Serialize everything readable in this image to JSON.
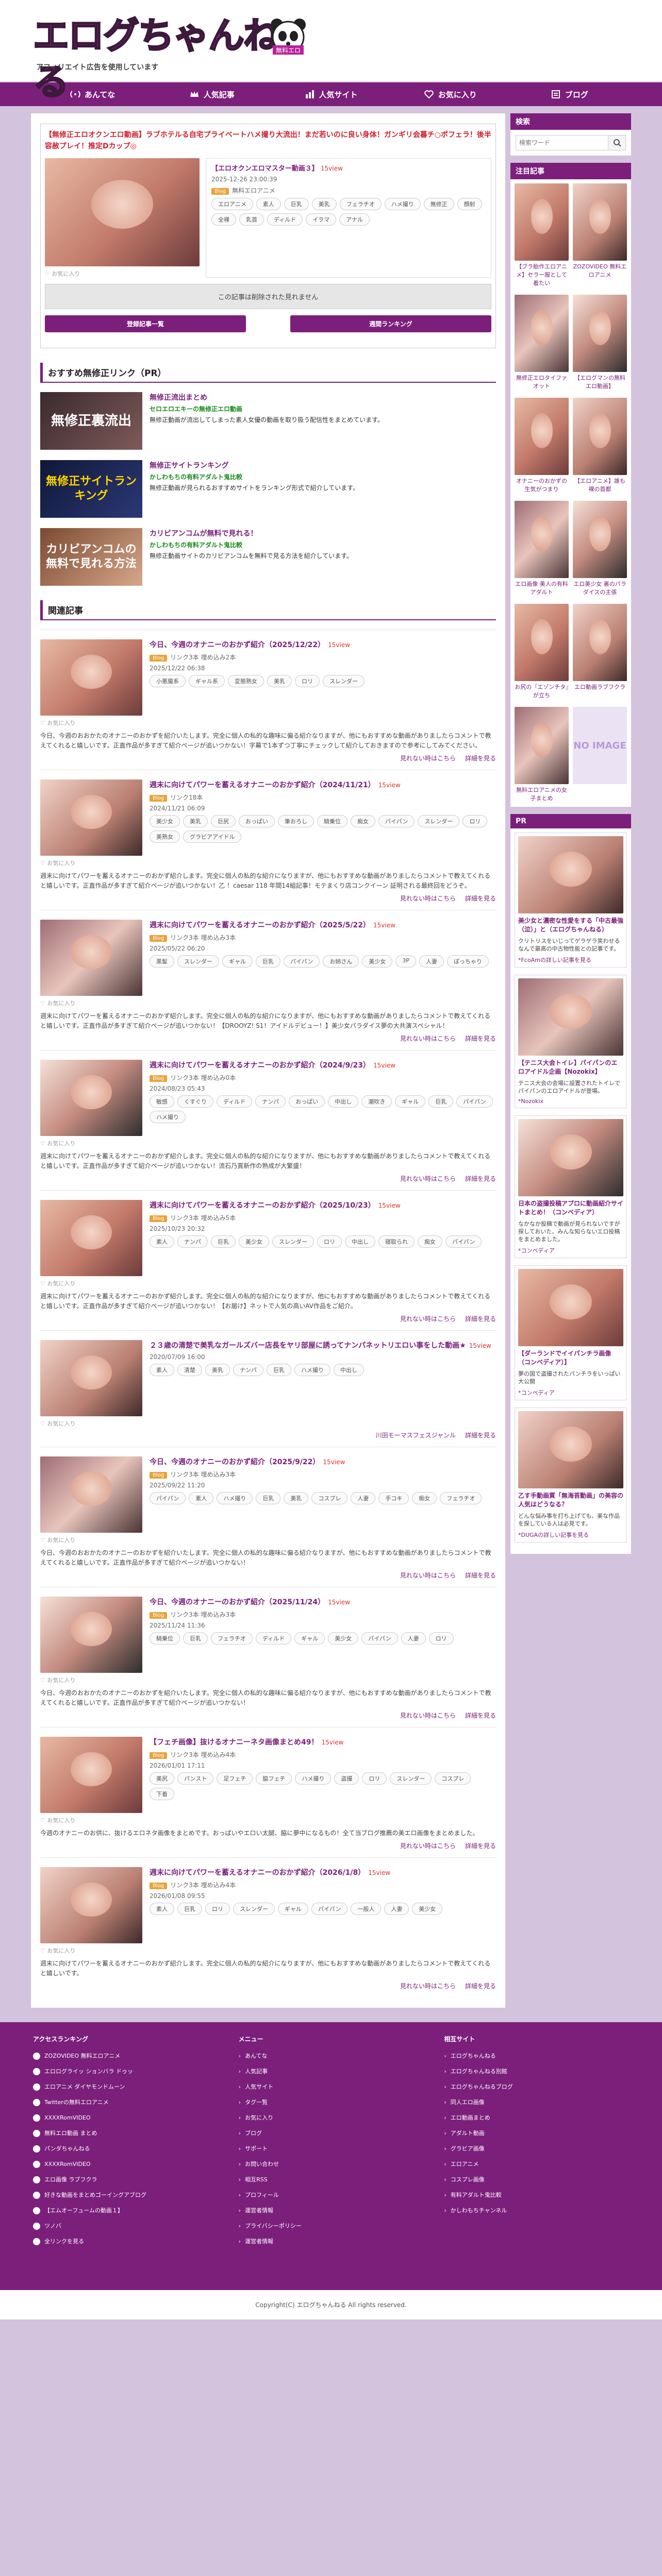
{
  "header": {
    "logo_text": "エログちゃんねる",
    "logo_badge": "無料エロ",
    "subtitle": "アフィリエイト広告を使用しています"
  },
  "nav": [
    {
      "label": "あんてな",
      "icon": "antenna-icon"
    },
    {
      "label": "人気記事",
      "icon": "crown-icon"
    },
    {
      "label": "人気サイト",
      "icon": "chart-icon"
    },
    {
      "label": "お気に入り",
      "icon": "heart-icon"
    },
    {
      "label": "ブログ",
      "icon": "book-icon"
    }
  ],
  "featured": {
    "title": "【無修正エロオクンエロ動画】ラブホテルる自宅プライベートハメ撮り大流出！まだ若いのに良い身体！ガンギリ会暮チ○ポフェラ！後半容赦プレイ！推定Dカップ◎",
    "link": "【エロオクンエロマスター動画３】",
    "pv": "15view",
    "date": "2025-12-26 23:00:39",
    "cat": "Blog",
    "meta_site": "無料エロアニメ",
    "tags": [
      "エロアニメ",
      "素人",
      "巨乳",
      "美乳",
      "フェラチオ",
      "ハメ撮り",
      "無修正",
      "顔射",
      "全裸",
      "乳首",
      "ディルド",
      "イラマ",
      "アナル"
    ],
    "fav": "お気に入り"
  },
  "ad_text": "この記事は削除された見れません",
  "btns": {
    "fav": "登録記事一覧",
    "rank": "週間ランキング"
  },
  "rec_heading": "おすすめ無修正リンク（PR）",
  "recs": [
    {
      "img": "無修正裏流出",
      "title": "無修正流出まとめ",
      "site": "セロエロエキーの無修正エロ動画",
      "desc": "無修正動画が流出してしまった素人女優の動画を取り扱う配信性をまとめています。"
    },
    {
      "img": "無修正サイトランキング",
      "title": "無修正サイトランキング",
      "site": "かしわもちの有料アダルト鬼比較",
      "desc": "無修正動画が見られるおすすめサイトをランキング形式で紹介しています。"
    },
    {
      "img": "カリビアンコムの 無料で見れる方法",
      "title": "カリビアンコムが無料で見れる！",
      "site": "かしわもちの有料アダルト鬼比較",
      "desc": "無修正動画サイトのカリビアンコムを無料で見る方法を紹介しています。"
    }
  ],
  "related_heading": "関連記事",
  "articles": [
    {
      "title": "今日、今週のオナニーのおかず紹介（2025/12/22）",
      "pv": "15view",
      "cat": "Blog",
      "meta": "リンク3本 埋め込み2本",
      "date": "2025/12/22 06:38",
      "tags": [
        "小悪魔系",
        "ギャル系",
        "変態熟女",
        "美乳",
        "ロリ",
        "スレンダー"
      ],
      "desc": "今日、今週のおおかたのオナニーのおかずを紹介いたします。完全に個人の私的な趣味に偏る紹介なりますが、他にもおすすめな動画がありましたらコメントで教えてくれると嬉しいです。正直作品が多すぎて紹介ページが追いつかない！字幕で1本ずつ丁寧にチェックして紹介しておきますので参考にしてみてください。",
      "more": [
        "見れない時はこちら",
        "詳細を見る"
      ]
    },
    {
      "title": "週末に向けてパワーを蓄えるオナニーのおかず紹介（2024/11/21）",
      "pv": "15view",
      "cat": "Blog",
      "meta": "リンク18本",
      "date": "2024/11/21 06:09",
      "tags": [
        "美少女",
        "美乳",
        "巨尻",
        "おっぱい",
        "筆おろし",
        "騎乗位",
        "痴女",
        "パイパン",
        "スレンダー",
        "ロリ",
        "美熟女",
        "グラビアアイドル"
      ],
      "desc": "週末に向けてパワーを蓄えるオナニーのおかず紹介します。完全に個人の私的な紹介になりますが、他にもおすすめな動画がありましたらコメントで教えてくれると嬉しいです。正直作品が多すぎて紹介ページが追いつかない！乙 ！caesar 118 年間14組記事！モテまくり店コンクイーン 証明される最終回をどうぞ。",
      "more": [
        "見れない時はこちら",
        "詳細を見る"
      ]
    },
    {
      "title": "週末に向けてパワーを蓄えるオナニーのおかず紹介（2025/5/22）",
      "pv": "15view",
      "cat": "Blog",
      "meta": "リンク3本 埋め込み3本",
      "date": "2025/05/22 06:20",
      "tags": [
        "黒髪",
        "スレンダー",
        "ギャル",
        "巨乳",
        "パイパン",
        "お姉さん",
        "美少女",
        "3P",
        "人妻",
        "ぽっちゃり"
      ],
      "desc": "週末に向けてパワーを蓄えるオナニーのおかず紹介します。完全に個人の私的な紹介になりますが、他にもおすすめな動画がありましたらコメントで教えてくれると嬉しいです。正直作品が多すぎて紹介ページが追いつかない！【DROOYZ! S1！アイドルデビュー！】美少女パラダイス夢の大共演スペシャル！",
      "more": [
        "見れない時はこちら",
        "詳細を見る"
      ]
    },
    {
      "title": "週末に向けてパワーを蓄えるオナニーのおかず紹介（2024/9/23）",
      "pv": "15view",
      "cat": "Blog",
      "meta": "リンク3本 埋め込み0本",
      "date": "2024/08/23 05:43",
      "tags": [
        "敏感",
        "くすぐり",
        "ディルド",
        "ナンパ",
        "おっぱい",
        "中出し",
        "潮吹き",
        "ギャル",
        "巨乳",
        "パイパン",
        "ハメ撮り"
      ],
      "desc": "週末に向けてパワーを蓄えるオナニーのおかず紹介します。完全に個人の私的な紹介になりますが、他にもおすすめな動画がありましたらコメントで教えてくれると嬉しいです。正直作品が多すぎて紹介ページが追いつかない！流石乃賞新作の熟成が大繁盛！",
      "more": [
        "見れない時はこちら",
        "詳細を見る"
      ]
    },
    {
      "title": "週末に向けてパワーを蓄えるオナニーのおかず紹介（2025/10/23）",
      "pv": "15view",
      "cat": "Blog",
      "meta": "リンク3本 埋め込み5本",
      "date": "2025/10/23 20:32",
      "tags": [
        "素人",
        "ナンパ",
        "巨乳",
        "美少女",
        "スレンダー",
        "ロリ",
        "中出し",
        "寝取られ",
        "痴女",
        "パイパン"
      ],
      "desc": "週末に向けてパワーを蓄えるオナニーのおかず紹介します。完全に個人の私的な紹介になりますが、他にもおすすめな動画がありましたらコメントで教えてくれると嬉しいです。正直作品が多すぎて紹介ページが追いつかない！【お届け】ネットで人気の高いAV作品をご紹介。",
      "more": [
        "見れない時はこちら",
        "詳細を見る"
      ]
    },
    {
      "title": "２３歳の清楚で美乳なガールズバー店長をヤリ部屋に誘ってナンパネットリエロい事をした動画★",
      "pv": "15view",
      "cat": "",
      "meta": "",
      "date": "2020/07/09 16:00",
      "tags": [
        "素人",
        "清楚",
        "美乳",
        "ナンパ",
        "巨乳",
        "ハメ撮り",
        "中出し"
      ],
      "desc": "",
      "more": [
        "川田モーマスフェスジャンル",
        "詳細を見る"
      ]
    },
    {
      "title": "今日、今週のオナニーのおかず紹介（2025/9/22）",
      "pv": "15view",
      "cat": "Blog",
      "meta": "リンク3本 埋め込み3本",
      "date": "2025/09/22 11:20",
      "tags": [
        "パイパン",
        "素人",
        "ハメ撮り",
        "巨乳",
        "美乳",
        "コスプレ",
        "人妻",
        "手コキ",
        "痴女",
        "フェラチオ"
      ],
      "desc": "今日、今週のおおかたのオナニーのおかずを紹介いたします。完全に個人の私的な趣味に偏る紹介なりますが、他にもおすすめな動画がありましたらコメントで教えてくれると嬉しいです。正直作品が多すぎて紹介ページが追いつかない！",
      "more": [
        "見れない時はこちら",
        "詳細を見る"
      ]
    },
    {
      "title": "今日、今週のオナニーのおかず紹介（2025/11/24）",
      "pv": "15view",
      "cat": "Blog",
      "meta": "リンク3本 埋め込み3本",
      "date": "2025/11/24 11:36",
      "tags": [
        "騎乗位",
        "巨乳",
        "フェラチオ",
        "ディルド",
        "ギャル",
        "美少女",
        "パイパン",
        "人妻",
        "ロリ"
      ],
      "desc": "今日、今週のおおかたのオナニーのおかずを紹介いたします。完全に個人の私的な趣味に偏る紹介なりますが、他にもおすすめな動画がありましたらコメントで教えてくれると嬉しいです。正直作品が多すぎて紹介ページが追いつかない！",
      "more": [
        "見れない時はこちら",
        "詳細を見る"
      ]
    },
    {
      "title": "【フェチ画像】抜けるオナニーネタ画像まとめ49！",
      "pv": "15view",
      "cat": "Blog",
      "meta": "リンク3本 埋め込み4本",
      "date": "2026/01/01 17:11",
      "tags": [
        "美尻",
        "パンスト",
        "足フェチ",
        "脇フェチ",
        "ハメ撮り",
        "盗撮",
        "ロリ",
        "スレンダー",
        "コスプレ",
        "下着"
      ],
      "desc": "今週のオナニーのお供に、抜けるエロネタ画像をまとめです。おっぱいやエロい太腿、脇に夢中になるもの！全て当ブログ推薦の美エロ画像をまとめました。",
      "more": [
        "見れない時はこちら",
        "詳細を見る"
      ]
    },
    {
      "title": "週末に向けてパワーを蓄えるオナニーのおかず紹介（2026/1/8）",
      "pv": "15view",
      "cat": "Blog",
      "meta": "リンク3本 埋め込み4本",
      "date": "2026/01/08 09:55",
      "tags": [
        "素人",
        "巨乳",
        "ロリ",
        "スレンダー",
        "ギャル",
        "パイパン",
        "一般人",
        "人妻",
        "美少女"
      ],
      "desc": "週末に向けてパワーを蓄えるオナニーのおかず紹介します。完全に個人の私的な紹介になりますが、他にもおすすめな動画がありましたらコメントで教えてくれると嬉しいです。",
      "more": [
        "見れない時はこちら",
        "詳細を見る"
      ]
    }
  ],
  "side": {
    "search_head": "検索",
    "search_ph": "検索ワード",
    "pick_head": "注目記事",
    "picks": [
      "【ブラ胎作エロアニメ】セラー服として着たい",
      "ZOZOVIDEO 無料エロアニメ",
      "無修正エロタイファオット",
      "【エログマンの無料エロ動画】",
      "オナニーのおかずの生気がつまり",
      "【エロアニメ】誰も裸の首都",
      "エロ画像 美人の有料アダルト",
      "エロ美少女 裏のパラダイスの主張",
      "お尻の『エゾンチタ』が立ち",
      "エロ動画ラブフクラ",
      "無料エロアニメの女子まとめ",
      "NO IMAGE"
    ],
    "pr_head": "PR",
    "prs": [
      {
        "title": "美少女と濃密な性愛をする「中古最強（泣）」と（エログちゃんねる）",
        "desc": "クリトリスをいじってゲラゲラ笑わせるなんで最高の中古物性能との記事です。",
        "link": "*FcoAmの詳しい記事を見る"
      },
      {
        "title": "【テニス大会トイレ】パイパンのエロアイドル企画【Nozokix】",
        "desc": "テニス大会の会場に設置されたトイレでパイパンのエロアイドルが登場。",
        "link": "*Nozokix"
      },
      {
        "title": "日本の盗撮投稿アプロに動画紹介サイトまとめ！（コンベディア）",
        "desc": "なかなか投稿で動画が見られないですが探しておいた、みんな知らないエロ投稿をまとめました。",
        "link": "*コンベディア"
      },
      {
        "title": "【ダーランドでイイパンチラ画像（コンベディア）】",
        "desc": "夢の国で盗撮されたパンチラをいっぱい大公開",
        "link": "*コンベディア"
      },
      {
        "title": "乙す手動画質「無海苔動画」の美容の人気はどうなる？",
        "desc": "どんな悩み事を打ち上げても、楽な作品を探している人は必見です。",
        "link": "*DUGAの詳しい記事を見る"
      }
    ]
  },
  "footer": {
    "c1_head": "アクセスランキング",
    "c1": [
      "ZOZOVIDEO 無料エロアニメ",
      "エロログライッ ションバラ ドゥッ",
      "エロアニメ ダイヤモンドムーン",
      "Twitterの無料エロアニメ",
      "XXXXRomVIDEO",
      "無料エロ動画 まとめ",
      "パンダちゃんねる",
      "XXXXRomVIDEO",
      "エロ画像 ラブフクラ",
      "好きな動画をまとめゴーイングアブログ",
      "【エムオーフュームの動画１】",
      "ツノバ",
      "全リンクを見る"
    ],
    "c2_head": "メニュー",
    "c2": [
      "あんてな",
      "人気記事",
      "人気サイト",
      "タグ一覧",
      "お気に入り",
      "ブログ",
      "サポート",
      "お問い合わせ",
      "相互RSS",
      "プロフィール",
      "運営者情報",
      "プライバシーポリシー",
      "運営者情報"
    ],
    "c3_head": "相互サイト",
    "c3": [
      "エログちゃんねる",
      "エログちゃんねる別館",
      "エログちゃんねるブログ",
      "同人エロ画像",
      "エロ動画まとめ",
      "アダルト動画",
      "グラビア画像",
      "エロアニメ",
      "コスプレ画像",
      "有料アダルト鬼比較",
      "かしわもちチャンネル"
    ]
  },
  "copyright": "Copyright(C) エログちゃんねる All rights reserved."
}
